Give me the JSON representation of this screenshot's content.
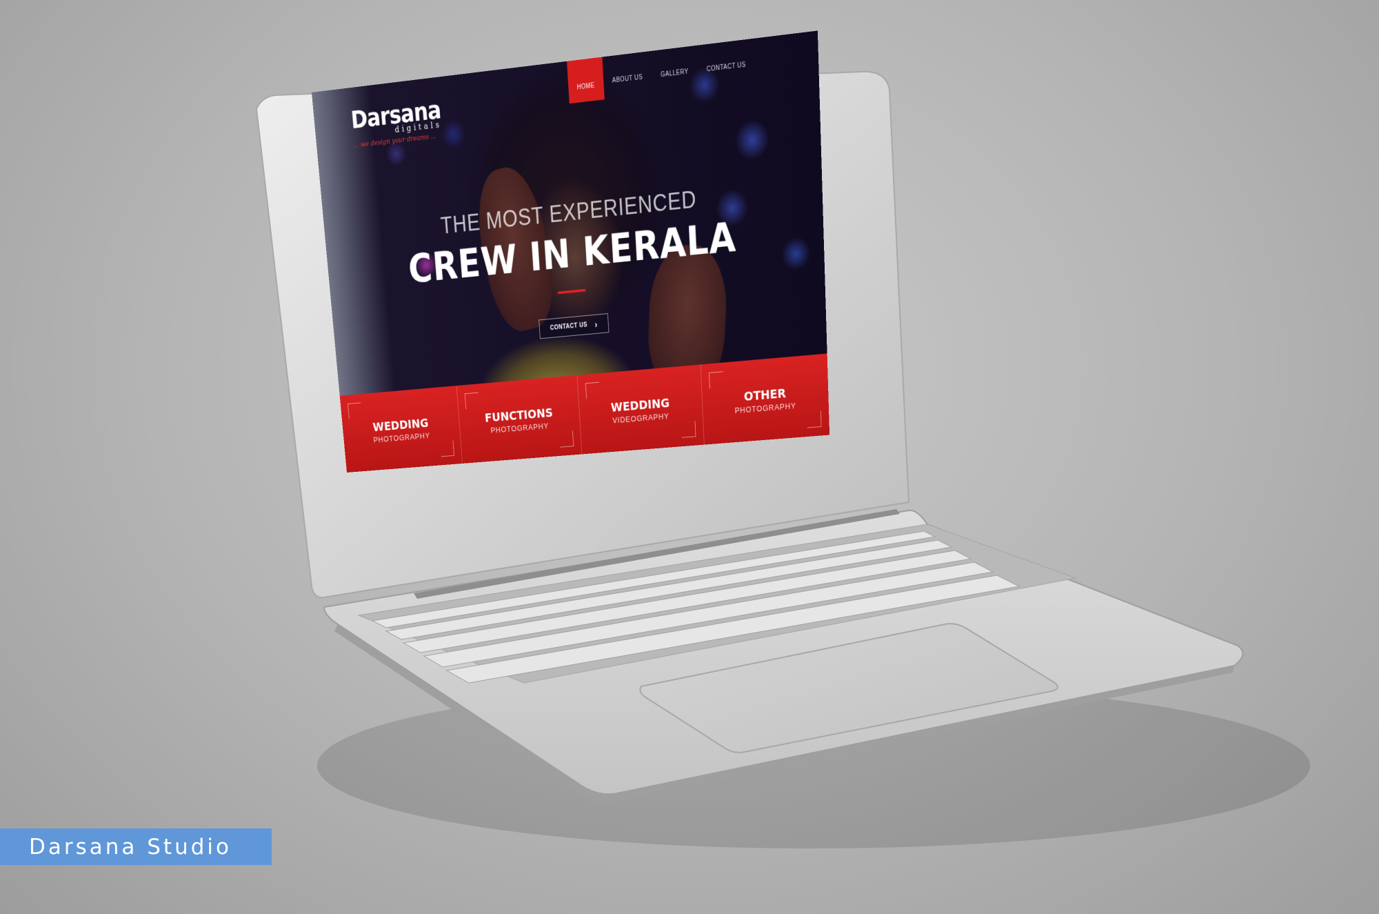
{
  "site": {
    "logo": {
      "name": "Darsana",
      "sub": "digitals",
      "tagline": "... we design your dreams ..."
    },
    "nav": [
      {
        "label": "HOME",
        "active": true
      },
      {
        "label": "ABOUT US",
        "active": false
      },
      {
        "label": "GALLERY",
        "active": false
      },
      {
        "label": "CONTACT US",
        "active": false
      }
    ],
    "hero": {
      "line1": "THE MOST EXPERIENCED",
      "line2": "CREW IN KERALA",
      "button": "CONTACT US"
    },
    "services": [
      {
        "title": "WEDDING",
        "sub": "PHOTOGRAPHY"
      },
      {
        "title": "FUNCTIONS",
        "sub": "PHOTOGRAPHY"
      },
      {
        "title": "WEDDING",
        "sub": "VIDEOGRAPHY"
      },
      {
        "title": "OTHER",
        "sub": "PHOTOGRAPHY"
      }
    ]
  },
  "watermark": "Darsana Studio",
  "colors": {
    "accent_red": "#d61e1e",
    "badge_blue": "#5f97d8"
  }
}
